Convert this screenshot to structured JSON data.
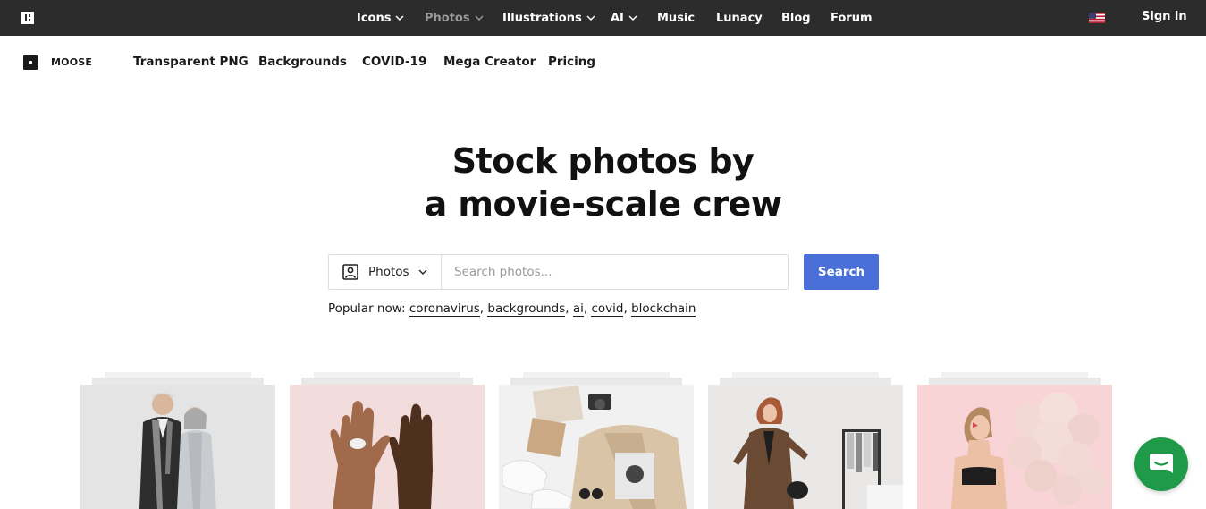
{
  "topbar": {
    "nav": [
      {
        "label": "Icons",
        "dropdown": true,
        "active": true
      },
      {
        "label": "Photos",
        "dropdown": true,
        "active": false
      },
      {
        "label": "Illustrations",
        "dropdown": true,
        "active": true
      },
      {
        "label": "AI",
        "dropdown": true,
        "active": true
      },
      {
        "label": "Music",
        "dropdown": false,
        "active": true
      },
      {
        "label": "Lunacy",
        "dropdown": false,
        "active": true
      },
      {
        "label": "Blog",
        "dropdown": false,
        "active": true
      },
      {
        "label": "Forum",
        "dropdown": false,
        "active": true
      }
    ],
    "language_icon": "us-flag-icon",
    "sign_in": "Sign in"
  },
  "subnav": {
    "brand": "MOOSE",
    "items": [
      "Transparent PNG",
      "Backgrounds",
      "COVID-19",
      "Mega Creator",
      "Pricing"
    ]
  },
  "hero": {
    "title_line1": "Stock photos by",
    "title_line2": "a movie-scale crew"
  },
  "search": {
    "category": "Photos",
    "placeholder": "Search photos...",
    "value": "",
    "button": "Search"
  },
  "popular": {
    "label": "Popular now:",
    "tags": [
      "coronavirus",
      "backgrounds",
      "ai",
      "covid",
      "blockchain"
    ]
  },
  "cards": [
    {
      "subject": "senior couple in coats",
      "bg": "#e4e4e4"
    },
    {
      "subject": "two hands with pill",
      "bg": "#f3dcdc"
    },
    {
      "subject": "flat lay fashion items",
      "bg": "#f1f1f1"
    },
    {
      "subject": "woman in brown suit",
      "bg": "#e6e6e6"
    },
    {
      "subject": "woman with pink balloons",
      "bg": "#f8d4d6"
    }
  ],
  "colors": {
    "topbar_bg": "#2c2c2c",
    "accent": "#4a6fd8",
    "help_button": "#1f9a48"
  },
  "help_icon": "chat-bubble-icon"
}
